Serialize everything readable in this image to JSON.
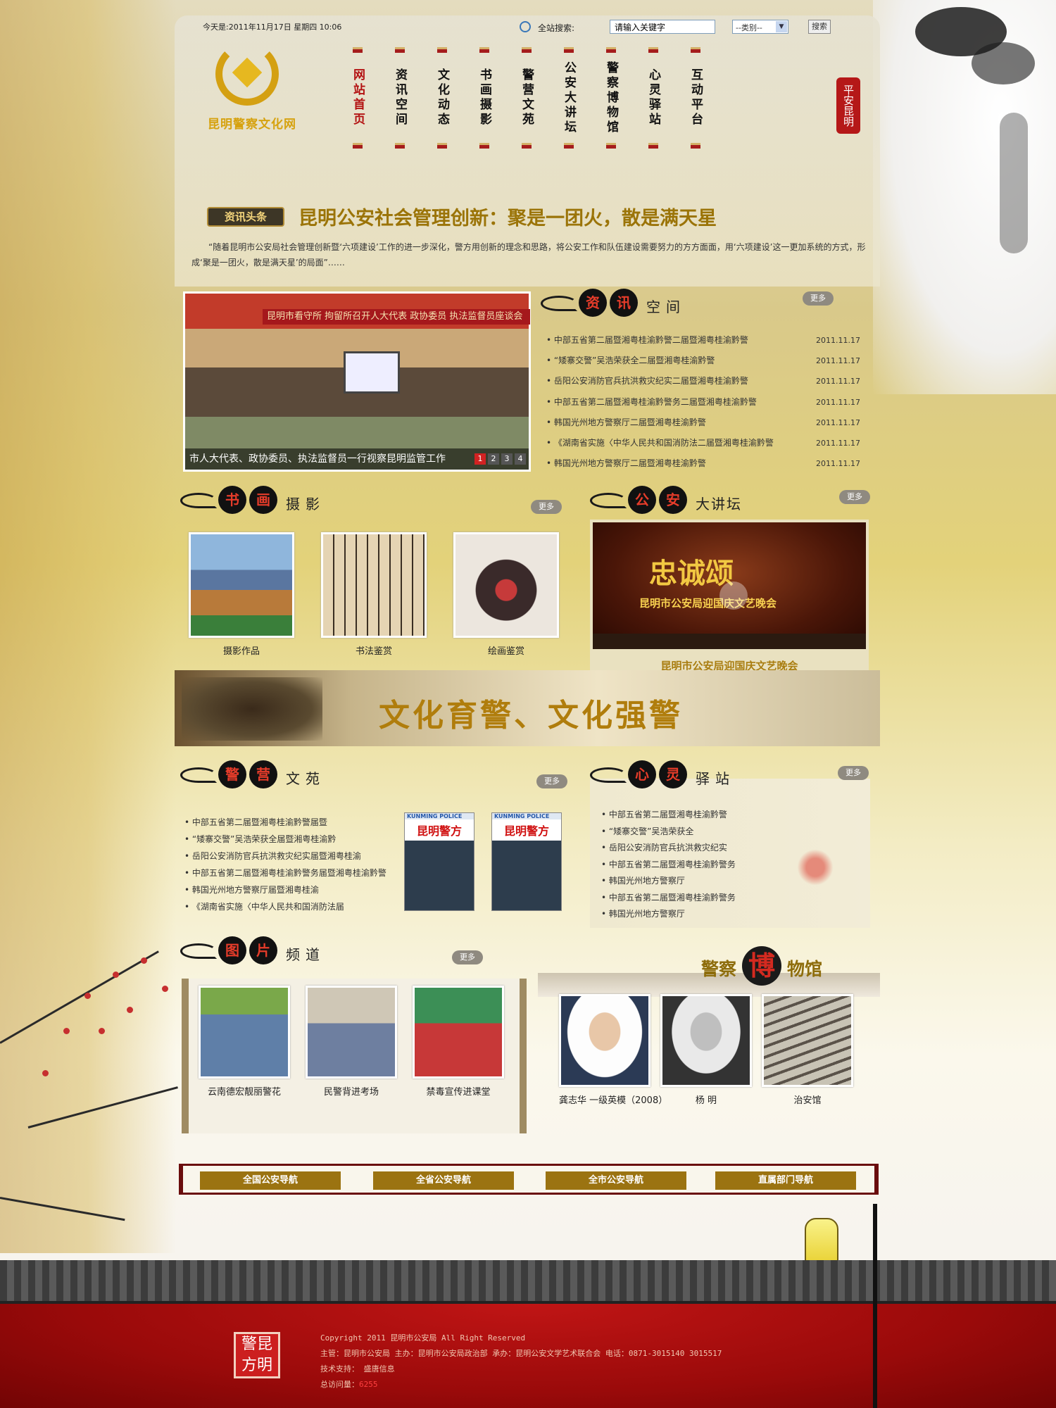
{
  "header": {
    "date_text": "今天是:2011年11月17日  星期四  10:06",
    "search_label": "全站搜索:",
    "search_placeholder": "请输入关键字",
    "category_value": "--类别--",
    "search_button": "搜索",
    "logo_text": "昆明警察文化网",
    "seal_text": "平安昆明"
  },
  "nav": {
    "items": [
      {
        "label": "网站首页"
      },
      {
        "label": "资讯空间"
      },
      {
        "label": "文化动态"
      },
      {
        "label": "书画摄影"
      },
      {
        "label": "警营文苑"
      },
      {
        "label": "公安大讲坛"
      },
      {
        "label": "警察博物馆"
      },
      {
        "label": "心灵驿站"
      },
      {
        "label": "互动平台"
      }
    ]
  },
  "headline": {
    "tag": "资讯头条",
    "title": "昆明公安社会管理创新：聚是一团火，散是满天星",
    "summary": "“随着昆明市公安局社会管理创新暨‘六项建设’工作的进一步深化，警方用创新的理念和思路，将公安工作和队伍建设需要努力的方方面面，用‘六项建设’这一更加系统的方式，形成‘聚是一团火，散是满天星’的局面”……"
  },
  "slider": {
    "banner_text": "昆明市看守所  拘留所召开人大代表  政协委员  执法监督员座谈会",
    "caption": "市人大代表、政协委员、执法监督员一行视察昆明监管工作",
    "pages": [
      "1",
      "2",
      "3",
      "4"
    ]
  },
  "news": {
    "badge1": "资",
    "badge2": "讯",
    "tail": "空间",
    "more": "更多",
    "items": [
      {
        "title": "中部五省第二届暨湘粤桂渝黔警二届暨湘粤桂渝黔警",
        "date": "2011.11.17"
      },
      {
        "title": "“矮寨交警”吴浩荣获全二届暨湘粤桂渝黔警",
        "date": "2011.11.17"
      },
      {
        "title": "岳阳公安消防官兵抗洪救灾纪实二届暨湘粤桂渝黔警",
        "date": "2011.11.17"
      },
      {
        "title": "中部五省第二届暨湘粤桂渝黔警务二届暨湘粤桂渝黔警",
        "date": "2011.11.17"
      },
      {
        "title": "韩国光州地方警察厅二届暨湘粤桂渝黔警",
        "date": "2011.11.17"
      },
      {
        "title": "《湖南省实施〈中华人民共和国消防法二届暨湘粤桂渝黔警",
        "date": "2011.11.17"
      },
      {
        "title": "韩国光州地方警察厅二届暨湘粤桂渝黔警",
        "date": "2011.11.17"
      }
    ]
  },
  "art": {
    "badge1": "书",
    "badge2": "画",
    "tail": "摄影",
    "more": "更多",
    "items": [
      {
        "label": "摄影作品",
        "color": "#5d8ac0"
      },
      {
        "label": "书法鉴赏",
        "color": "#d9c5a2"
      },
      {
        "label": "绘画鉴赏",
        "color": "#3a2626"
      }
    ]
  },
  "lecture": {
    "badge1": "公",
    "badge2": "安",
    "tail": "大讲坛",
    "more": "更多",
    "video_title": "忠诚颂",
    "video_sub": "昆明市公安局迎国庆文艺晚会",
    "caption": "昆明市公安局迎国庆文艺晚会"
  },
  "culture_banner": {
    "text": "文化育警、文化强警"
  },
  "literature": {
    "badge1": "警",
    "badge2": "营",
    "tail": "文苑",
    "more": "更多",
    "items": [
      "中部五省第二届暨湘粤桂渝黔警届暨",
      "“矮寨交警”吴浩荣获全届暨湘粤桂渝黔",
      "岳阳公安消防官兵抗洪救灾纪实届暨湘粤桂渝",
      "中部五省第二届暨湘粤桂渝黔警务届暨湘粤桂渝黔警",
      "韩国光州地方警察厅届暨湘粤桂渝",
      "《湖南省实施〈中华人民共和国消防法届"
    ],
    "magazine_kicker": "KUNMING POLICE",
    "magazine_title": "昆明警方"
  },
  "heart": {
    "badge1": "心",
    "badge2": "灵",
    "tail": "驿站",
    "more": "更多",
    "items": [
      "中部五省第二届暨湘粤桂渝黔警",
      "“矮寨交警”吴浩荣获全",
      "岳阳公安消防官兵抗洪救灾纪实",
      "中部五省第二届暨湘粤桂渝黔警务",
      "韩国光州地方警察厅",
      "中部五省第二届暨湘粤桂渝黔警务",
      "韩国光州地方警察厅"
    ]
  },
  "photos": {
    "badge1": "图",
    "badge2": "片",
    "tail": "频道",
    "more": "更多",
    "items": [
      {
        "label": "云南德宏靓丽警花"
      },
      {
        "label": "民警背进考场"
      },
      {
        "label": "禁毒宣传进课堂"
      }
    ]
  },
  "museum": {
    "title_left": "警察",
    "title_big": "博",
    "title_right": "物馆",
    "items": [
      {
        "label": "龚志华 一级英模（2008）"
      },
      {
        "label": "杨  明"
      },
      {
        "label": "治安馆"
      }
    ]
  },
  "bottom_nav": [
    "全国公安导航",
    "全省公安导航",
    "全市公安导航",
    "直属部门导航"
  ],
  "footer": {
    "seal": "警昆方明",
    "copyright": "Copyright 2011 昆明市公安局 All Right Reserved",
    "sponsor": "主管：昆明市公安局    主办：昆明市公安局政治部    承办：昆明公安文学艺术联合会    电话：0871-3015140 3015517",
    "tech": "技术支持： 盛唐信息",
    "visits_label": "总访问量：",
    "visits": "6255"
  }
}
